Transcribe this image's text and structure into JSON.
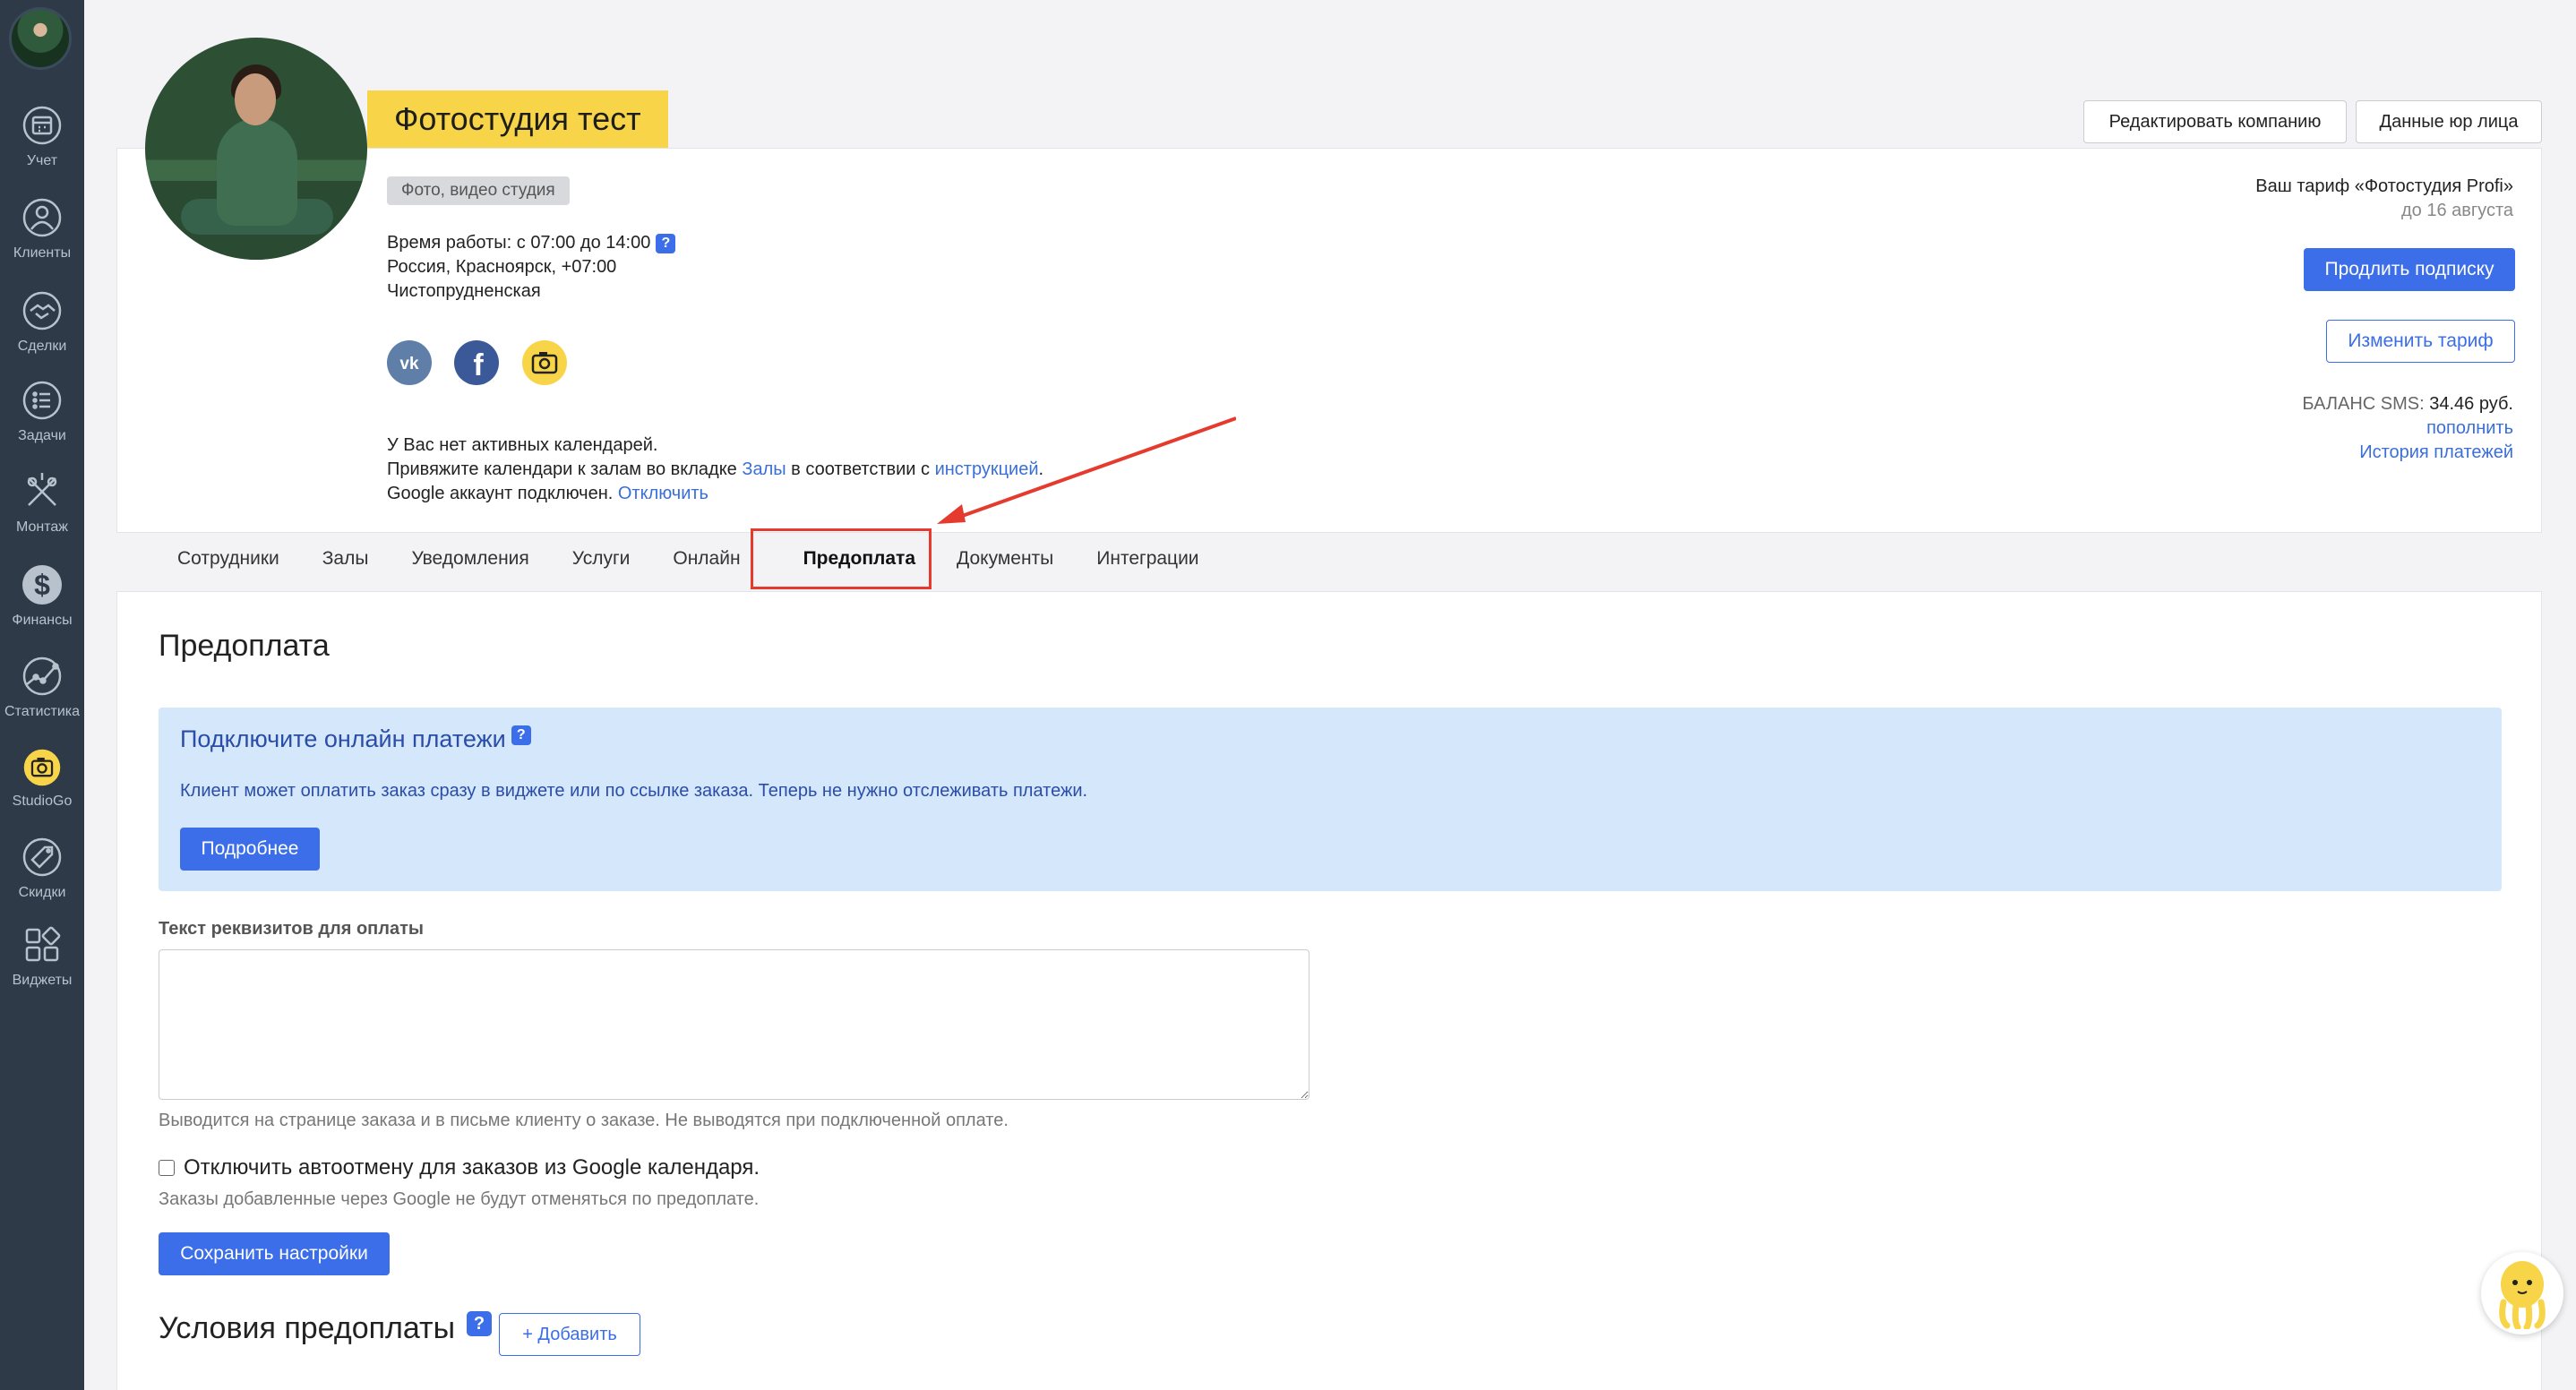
{
  "sidebar": {
    "items": [
      {
        "label": "Учет",
        "icon": "calendar-icon"
      },
      {
        "label": "Клиенты",
        "icon": "user-icon"
      },
      {
        "label": "Сделки",
        "icon": "handshake-icon"
      },
      {
        "label": "Задачи",
        "icon": "tasks-icon"
      },
      {
        "label": "Монтаж",
        "icon": "edit-tools-icon"
      },
      {
        "label": "Финансы",
        "icon": "dollar-icon"
      },
      {
        "label": "Статистика",
        "icon": "chart-icon"
      },
      {
        "label": "StudioGo",
        "icon": "studiogo-camera-icon"
      },
      {
        "label": "Скидки",
        "icon": "sale-tag-icon"
      },
      {
        "label": "Виджеты",
        "icon": "widgets-icon"
      }
    ]
  },
  "company": {
    "title": "Фотостудия тест",
    "category": "Фото, видео студия",
    "hours": "Время работы: с 07:00 до 14:00",
    "location": "Россия, Красноярск, +07:00",
    "address": "Чистопрудненская",
    "calendar_notice": "У Вас нет активных календарей.",
    "calendar_bind_prefix": "Привяжите календари к залам во вкладке ",
    "calendar_bind_link": "Залы",
    "calendar_bind_middle": " в соответствии с ",
    "calendar_bind_link2": "инструкцией",
    "calendar_bind_suffix": ".",
    "google_status": "Google аккаунт подключен. ",
    "google_disconnect": "Отключить",
    "help_mark": "?"
  },
  "top_buttons": {
    "edit_company": "Редактировать компанию",
    "legal_data": "Данные юр лица"
  },
  "tariff": {
    "label": "Ваш тариф «Фотостудия Profi»",
    "until": "до 16 августа",
    "extend_button": "Продлить подписку",
    "change_button": "Изменить тариф",
    "sms_balance_label": "БАЛАНС SMS: ",
    "sms_balance_value": "34.46 руб.",
    "top_up": "пополнить",
    "history": "История платежей"
  },
  "tabs": [
    {
      "label": "Сотрудники",
      "active": false
    },
    {
      "label": "Залы",
      "active": false
    },
    {
      "label": "Уведомления",
      "active": false
    },
    {
      "label": "Услуги",
      "active": false
    },
    {
      "label": "Онлайн",
      "active": false
    },
    {
      "label": "Предоплата",
      "active": true
    },
    {
      "label": "Документы",
      "active": false
    },
    {
      "label": "Интеграции",
      "active": false
    }
  ],
  "main": {
    "title": "Предоплата",
    "promo": {
      "title": "Подключите онлайн платежи",
      "text": "Клиент может оплатить заказ сразу в виджете или по ссылке заказа. Теперь не нужно отслеживать платежи.",
      "button": "Подробнее"
    },
    "requisites_label": "Текст реквизитов для оплаты",
    "requisites_value": "",
    "requisites_hint": "Выводится на странице заказа и в письме клиенту о заказе. Не выводятся при подключенной оплате.",
    "autocancel_label": "Отключить автоотмену для заказов из Google календаря.",
    "autocancel_checked": false,
    "autocancel_hint": "Заказы добавленные через Google не будут отменяться по предоплате.",
    "save_button": "Сохранить настройки",
    "conditions_title": "Условия предоплаты",
    "add_button": "+ Добавить"
  },
  "colors": {
    "sidebar_bg": "#2e3a48",
    "accent_blue": "#3b6ee8",
    "title_yellow": "#f8d548",
    "promo_bg": "#d5e7fb",
    "highlight_red": "#e53b2f"
  }
}
